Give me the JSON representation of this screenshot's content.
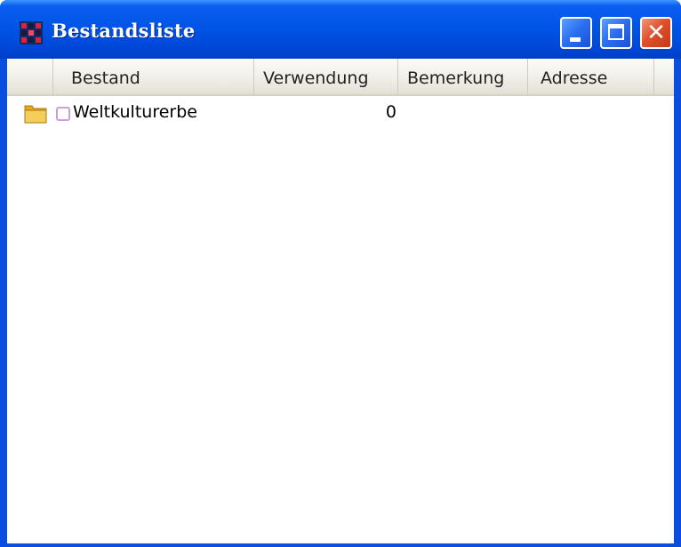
{
  "window": {
    "title": "Bestandsliste",
    "app_icon": "grid-app-icon",
    "controls": {
      "minimize": "minimize-icon",
      "maximize": "maximize-icon",
      "close": "close-icon",
      "close_glyph": "✕"
    }
  },
  "table": {
    "columns": [
      "Bestand",
      "Verwendung",
      "Bemerkung",
      "Adresse"
    ],
    "rows": [
      {
        "icon": "folder-icon",
        "checkbox": "checkbox-icon",
        "bestand": "Weltkulturerbe",
        "verwendung": "0",
        "bemerkung": "",
        "adresse": ""
      }
    ]
  },
  "colors": {
    "titlebar": "#0055e6",
    "close_button": "#e0502c",
    "folder": "#f2c24a",
    "checkbox_border": "#c9a0dc"
  }
}
